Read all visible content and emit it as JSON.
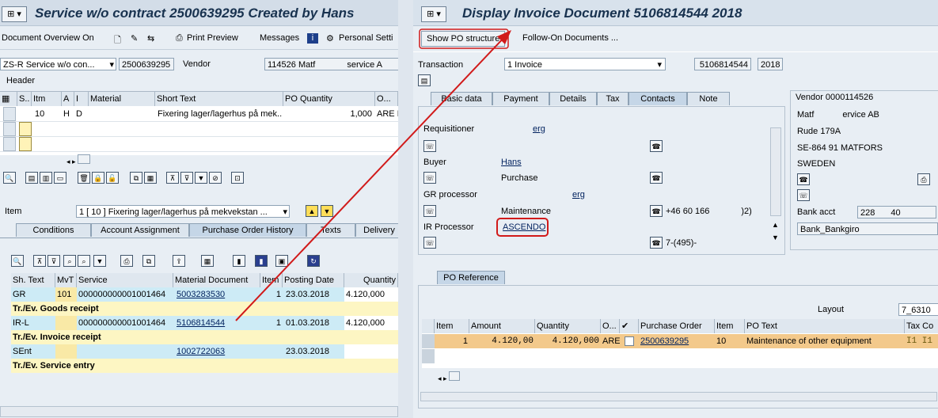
{
  "left": {
    "title": "Service w/o contract 2500639295 Created by Hans",
    "toolbar": {
      "doc_overview": "Document Overview On",
      "print_preview": "Print Preview",
      "messages": "Messages",
      "personal_settings": "Personal Setti"
    },
    "doc_type": "ZS-R Service w/o con...",
    "po_number": "2500639295",
    "vendor_label": "Vendor",
    "vendor_value": "114526 Matf",
    "vendor_value_tail": "service A",
    "header_label": "Header",
    "item_grid": {
      "columns": [
        "S..",
        "Itm",
        "A",
        "I",
        "Material",
        "Short Text",
        "PO Quantity",
        "O..."
      ],
      "rows": [
        {
          "itm": "10",
          "a": "H",
          "i": "D",
          "material": "",
          "short_text": "Fixering lager/lagerhus på mek...",
          "qty": "1,000",
          "unit": "ARE I"
        }
      ]
    },
    "item_label": "Item",
    "item_select": "1 [ 10 ] Fixering lager/lagerhus på mekvekstan ...",
    "tabs": [
      "Conditions",
      "Account Assignment",
      "Purchase Order History",
      "Texts",
      "Delivery"
    ],
    "history": {
      "columns": [
        "Sh. Text",
        "MvT",
        "Service",
        "Material Document",
        "Item",
        "Posting Date",
        "Quantity"
      ],
      "rows": [
        {
          "type": "data",
          "sh": "GR",
          "mvt": "101",
          "service": "000000000001001464",
          "doc": "5003283530",
          "item": "1",
          "date": "23.03.2018",
          "qty": "4.120,000"
        },
        {
          "type": "total",
          "text": "Tr./Ev. Goods receipt"
        },
        {
          "type": "data",
          "sh": "IR-L",
          "mvt": "",
          "service": "000000000001001464",
          "doc": "5106814544",
          "item": "1",
          "date": "01.03.2018",
          "qty": "4.120,000"
        },
        {
          "type": "total",
          "text": "Tr./Ev. Invoice receipt"
        },
        {
          "type": "data",
          "sh": "SEnt",
          "mvt": "",
          "service": "",
          "doc": "1002722063",
          "item": "",
          "date": "23.03.2018",
          "qty": ""
        },
        {
          "type": "total",
          "text": "Tr./Ev. Service entry"
        }
      ]
    }
  },
  "right": {
    "title": "Display Invoice Document 5106814544 2018",
    "btn_show_po": "Show PO structure",
    "btn_followon": "Follow-On Documents ...",
    "transaction_label": "Transaction",
    "transaction_value": "1 Invoice",
    "doc_number": "5106814544",
    "year": "2018",
    "tabs": [
      "Basic data",
      "Payment",
      "Details",
      "Tax",
      "Contacts",
      "Note"
    ],
    "contacts": {
      "requisitioner_label": "Requisitioner",
      "requisitioner_value": "erg",
      "buyer_label": "Buyer",
      "buyer_value": "Hans",
      "buyer_sub": "Purchase",
      "gr_label": "GR processor",
      "gr_value": "erg",
      "gr_sub": "Maintenance",
      "gr_phone": "+46 60 166",
      "gr_phone_tail": ")2)",
      "ir_label": "IR Processor",
      "ir_value": "ASCENDO",
      "ir_phone": "7-(495)-"
    },
    "vendor": {
      "title": "Vendor 0000114526",
      "name": "Matf",
      "name_tail": "ervice AB",
      "street": "Rude 179A",
      "city": "SE-864 91 MATFORS",
      "country": "SWEDEN",
      "bank_label": "Bank acct",
      "bank_value": "228",
      "bank_tail": "40",
      "bank_giro": "Bank_Bankgiro"
    },
    "po_ref_tab": "PO Reference",
    "layout_label": "Layout",
    "layout_value": "7_6310",
    "po_grid": {
      "columns": [
        "Item",
        "Amount",
        "Quantity",
        "O...",
        "",
        "Purchase Order",
        "Item",
        "PO Text",
        "Tax Co"
      ],
      "rows": [
        {
          "item": "1",
          "amount": "4.120,00",
          "qty": "4.120,000",
          "unit": "ARE",
          "po": "2500639295",
          "po_item": "10",
          "text": "Maintenance of other equipment",
          "tax": "I1 I1"
        }
      ]
    }
  },
  "colors": {
    "accent_red": "#d11a1a",
    "selected_row": "#f3c98b",
    "total_row": "#fdf6c3"
  }
}
